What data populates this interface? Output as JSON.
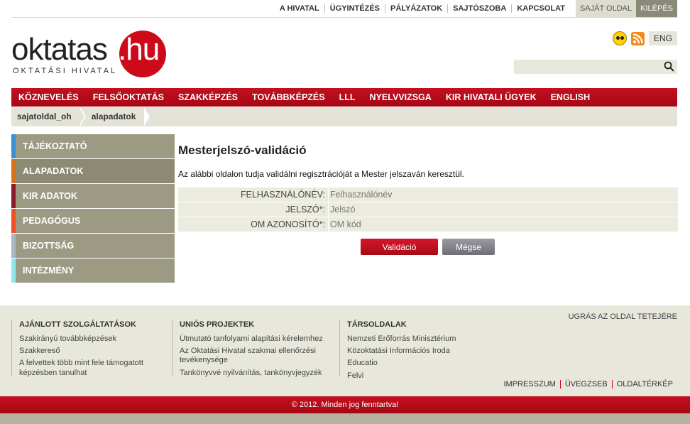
{
  "top_nav": {
    "links": [
      "A HIVATAL",
      "ÜGYINTÉZÉS",
      "PÁLYÁZATOK",
      "SAJTÓSZOBA",
      "KAPCSOLAT"
    ],
    "sajat_oldal": "SAJÁT OLDAL",
    "kilepes": "KILÉPÉS"
  },
  "logo": {
    "word": "oktatas",
    "tld": ".hu",
    "subtitle": "OKTATÁSI HIVATAL"
  },
  "header": {
    "lang_label": "ENG",
    "icons": [
      "accessibility-icon",
      "rss-icon",
      "search-icon"
    ],
    "search": {
      "value": "",
      "placeholder": ""
    }
  },
  "main_nav": [
    "KÖZNEVELÉS",
    "FELSŐOKTATÁS",
    "SZAKKÉPZÉS",
    "TOVÁBBKÉPZÉS",
    "LLL",
    "NYELVVIZSGA",
    "KIR HIVATALI ÜGYEK",
    "ENGLISH"
  ],
  "breadcrumb": [
    "sajatoldal_oh",
    "alapadatok"
  ],
  "side_menu": [
    {
      "label": "TÁJÉKOZTATÓ",
      "color": "#3a8fd0"
    },
    {
      "label": "ALAPADATOK",
      "color": "#d8731c"
    },
    {
      "label": "KIR ADATOK",
      "color": "#8b1a2a"
    },
    {
      "label": "PEDAGÓGUS",
      "color": "#f04e23"
    },
    {
      "label": "BIZOTTSÁG",
      "color": "#a7b8c4"
    },
    {
      "label": "INTÉZMÉNY",
      "color": "#8fe7ee"
    }
  ],
  "content": {
    "title": "Mesterjelszó-validáció",
    "intro": "Az alábbi oldalon tudja validálni regisztrációját a Mester jelszaván keresztül.",
    "fields": [
      {
        "label": "FELHASZNÁLÓNÉV:",
        "placeholder": "Felhasználónév",
        "value": ""
      },
      {
        "label": "JELSZÓ*:",
        "placeholder": "Jelszó",
        "value": ""
      },
      {
        "label": "OM AZONOSÍTÓ*:",
        "placeholder": "OM kód",
        "value": ""
      }
    ],
    "validate_label": "Validáció",
    "cancel_label": "Mégse"
  },
  "footer": {
    "to_top": "UGRÁS AZ OLDAL TETEJÉRE",
    "columns": [
      {
        "title": "AJÁNLOTT SZOLGÁLTATÁSOK",
        "links": [
          "Szakirányú továbbképzések",
          "Szakkereső",
          "A felvettek több mint fele támogatott képzésben tanulhat"
        ]
      },
      {
        "title": "UNIÓS PROJEKTEK",
        "links": [
          "Útmutató tanfolyami alapítási kérelemhez",
          "Az Oktatási Hivatal szakmai ellenőrzési tevékenysége",
          "Tankönyvvé nyilvánítás, tankönyvjegyzék"
        ]
      },
      {
        "title": "TÁRSOLDALAK",
        "links": [
          "Nemzeti Erőforrás Minisztérium",
          "Közoktatási Információs Iroda",
          "Educatio",
          "Felvi"
        ]
      }
    ],
    "bottom_links": [
      "IMPRESSZUM",
      "ÜVEGZSEB",
      "OLDALTÉRKÉP"
    ],
    "copyright": "© 2012. Minden jog fenntartva!"
  },
  "colors": {
    "brand_red": "#cc0a1a",
    "menu_bg": "#9d9a84",
    "panel_bg": "#e8e7db"
  }
}
